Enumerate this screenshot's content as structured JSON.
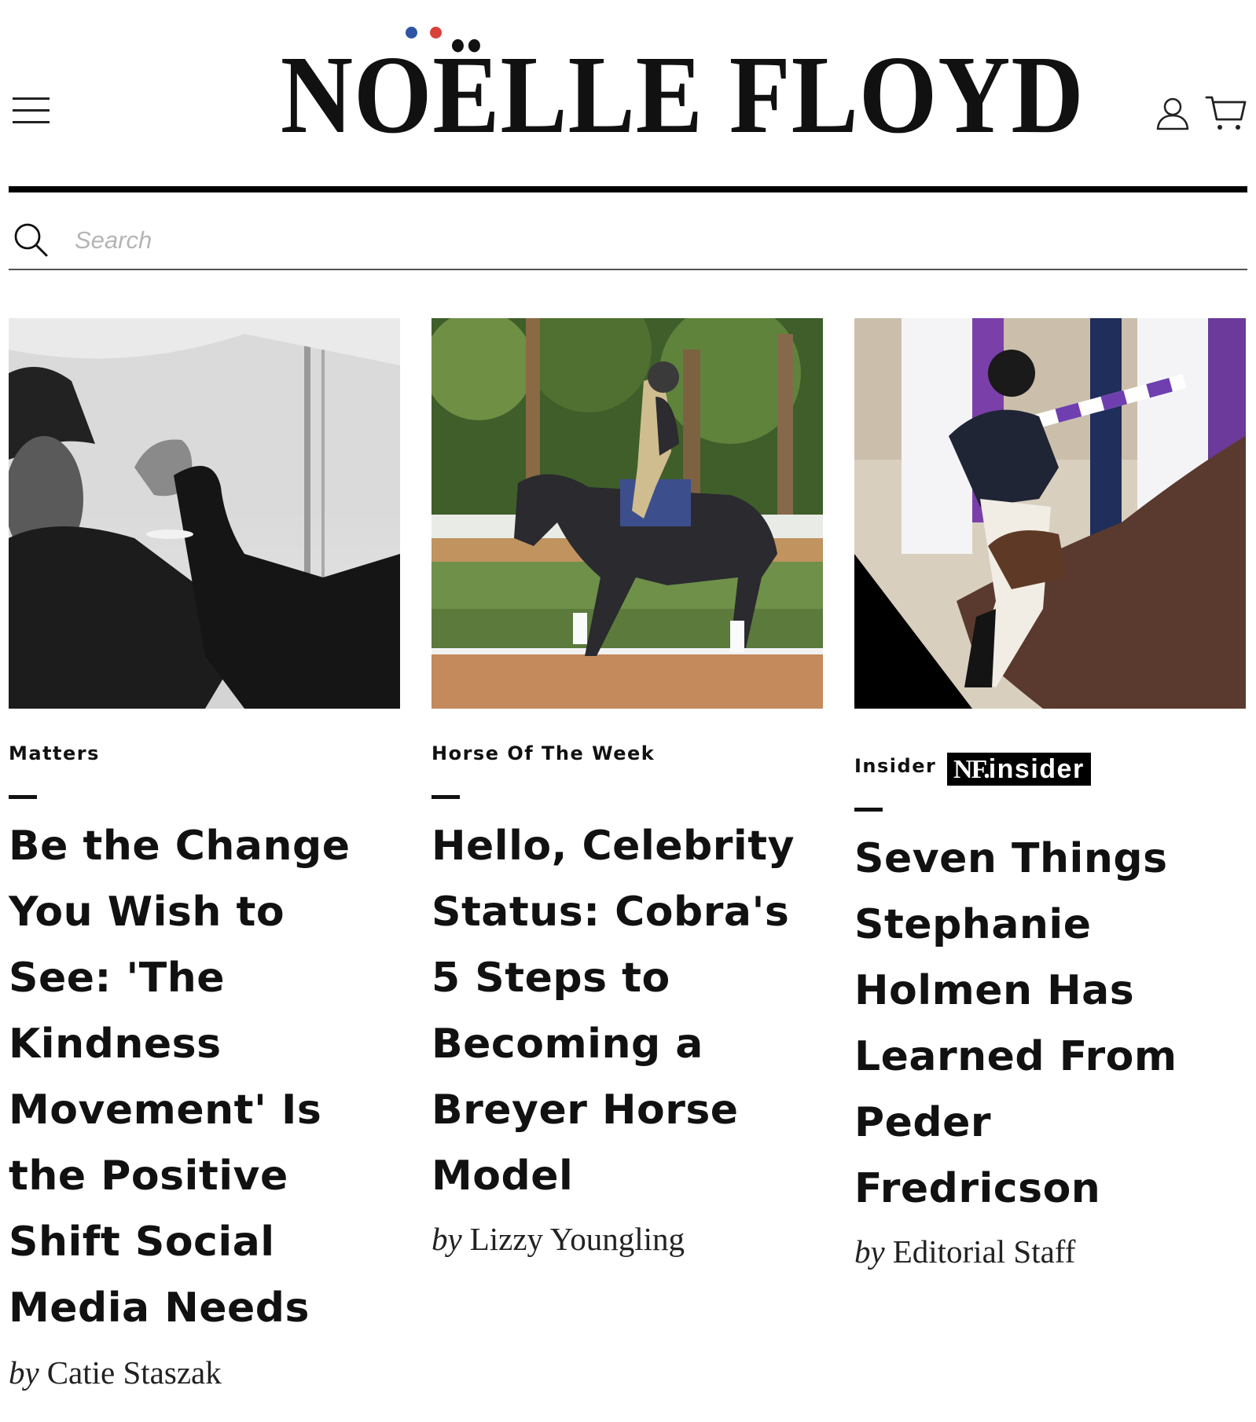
{
  "header": {
    "logo_text": "NOËLLE FLOYD",
    "dot_colors": {
      "blue": "#2f55a4",
      "red": "#d9423a"
    }
  },
  "search": {
    "placeholder": "Search"
  },
  "articles": [
    {
      "category": "Matters",
      "headline": "Be the Change You Wish to See: 'The Kindness Movement' Is the Positive Shift Social Media Needs",
      "by": "by",
      "author": "Catie Staszak"
    },
    {
      "category": "Horse Of The Week",
      "headline": "Hello, Celebrity Status: Cobra's 5 Steps to Becoming a Breyer Horse Model",
      "by": "by",
      "author": "Lizzy Youngling"
    },
    {
      "category": "Insider",
      "badge_nf": "NF.",
      "badge_text": "insider",
      "headline": "Seven Things Stephanie Holmen Has Learned From Peder Fredricson",
      "by": "by",
      "author": "Editorial Staff"
    }
  ],
  "icons": [
    "menu-icon",
    "user-icon",
    "cart-icon",
    "search-icon"
  ]
}
